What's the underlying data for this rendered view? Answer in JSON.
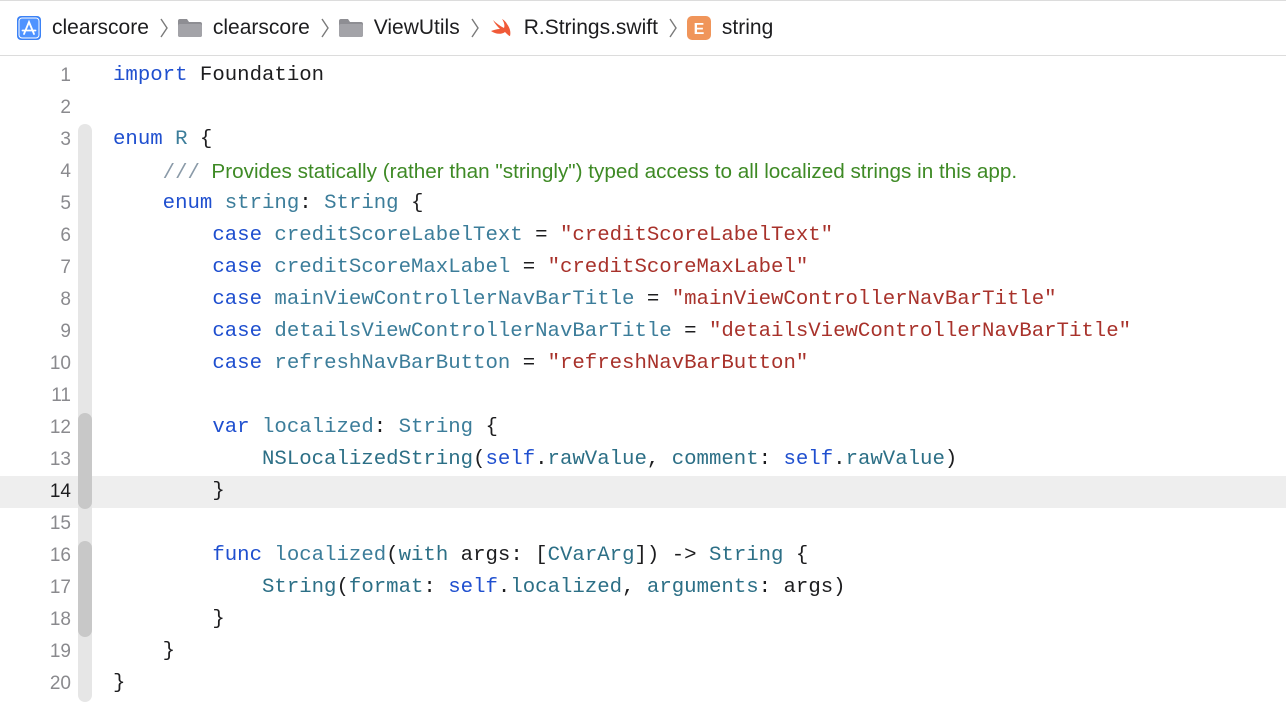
{
  "breadcrumb": [
    {
      "label": "clearscore",
      "icon": "app-project-icon"
    },
    {
      "label": "clearscore",
      "icon": "folder-icon"
    },
    {
      "label": "ViewUtils",
      "icon": "folder-icon"
    },
    {
      "label": "R.Strings.swift",
      "icon": "swift-file-icon"
    },
    {
      "label": "string",
      "icon": "enum-icon",
      "icon_letter": "E"
    }
  ],
  "colors": {
    "keyword": "#1f4fcf",
    "type": "#3c7d9a",
    "string": "#a8322b",
    "comment": "#3e8a25",
    "enum_badge": "#f0955a",
    "app_icon": "#3b82f6"
  },
  "editor": {
    "current_line": 14,
    "lines": [
      {
        "n": "1",
        "tokens": [
          [
            "kw",
            "import"
          ],
          [
            "pl",
            " Foundation"
          ]
        ]
      },
      {
        "n": "2",
        "tokens": []
      },
      {
        "n": "3",
        "tokens": [
          [
            "kw",
            "enum"
          ],
          [
            "pl",
            " "
          ],
          [
            "ty",
            "R"
          ],
          [
            "pl",
            " {"
          ]
        ]
      },
      {
        "n": "4",
        "tokens": [
          [
            "pl",
            "    "
          ],
          [
            "cmt-slash",
            "///"
          ],
          [
            "cmt",
            "  Provides statically (rather than \"stringly\") typed access to all localized strings in this app."
          ]
        ]
      },
      {
        "n": "5",
        "tokens": [
          [
            "pl",
            "    "
          ],
          [
            "kw",
            "enum"
          ],
          [
            "pl",
            " "
          ],
          [
            "ty",
            "string"
          ],
          [
            "pl",
            ": "
          ],
          [
            "ty",
            "String"
          ],
          [
            "pl",
            " {"
          ]
        ]
      },
      {
        "n": "6",
        "tokens": [
          [
            "pl",
            "        "
          ],
          [
            "kw",
            "case"
          ],
          [
            "pl",
            " "
          ],
          [
            "ty",
            "creditScoreLabelText"
          ],
          [
            "pl",
            " = "
          ],
          [
            "str",
            "\"creditScoreLabelText\""
          ]
        ]
      },
      {
        "n": "7",
        "tokens": [
          [
            "pl",
            "        "
          ],
          [
            "kw",
            "case"
          ],
          [
            "pl",
            " "
          ],
          [
            "ty",
            "creditScoreMaxLabel"
          ],
          [
            "pl",
            " = "
          ],
          [
            "str",
            "\"creditScoreMaxLabel\""
          ]
        ]
      },
      {
        "n": "8",
        "tokens": [
          [
            "pl",
            "        "
          ],
          [
            "kw",
            "case"
          ],
          [
            "pl",
            " "
          ],
          [
            "ty",
            "mainViewControllerNavBarTitle"
          ],
          [
            "pl",
            " = "
          ],
          [
            "str",
            "\"mainViewControllerNavBarTitle\""
          ]
        ]
      },
      {
        "n": "9",
        "tokens": [
          [
            "pl",
            "        "
          ],
          [
            "kw",
            "case"
          ],
          [
            "pl",
            " "
          ],
          [
            "ty",
            "detailsViewControllerNavBarTitle"
          ],
          [
            "pl",
            " = "
          ],
          [
            "str",
            "\"detailsViewControllerNavBarTitle\""
          ]
        ]
      },
      {
        "n": "10",
        "tokens": [
          [
            "pl",
            "        "
          ],
          [
            "kw",
            "case"
          ],
          [
            "pl",
            " "
          ],
          [
            "ty",
            "refreshNavBarButton"
          ],
          [
            "pl",
            " = "
          ],
          [
            "str",
            "\"refreshNavBarButton\""
          ]
        ]
      },
      {
        "n": "11",
        "tokens": []
      },
      {
        "n": "12",
        "tokens": [
          [
            "pl",
            "        "
          ],
          [
            "kw",
            "var"
          ],
          [
            "pl",
            " "
          ],
          [
            "ty",
            "localized"
          ],
          [
            "pl",
            ": "
          ],
          [
            "ty",
            "String"
          ],
          [
            "pl",
            " {"
          ]
        ]
      },
      {
        "n": "13",
        "tokens": [
          [
            "pl",
            "            "
          ],
          [
            "cl",
            "NSLocalizedString"
          ],
          [
            "pl",
            "("
          ],
          [
            "kw",
            "self"
          ],
          [
            "pl",
            "."
          ],
          [
            "cl",
            "rawValue"
          ],
          [
            "pl",
            ", "
          ],
          [
            "cl",
            "comment"
          ],
          [
            "pl",
            ": "
          ],
          [
            "kw",
            "self"
          ],
          [
            "pl",
            "."
          ],
          [
            "cl",
            "rawValue"
          ],
          [
            "pl",
            ")"
          ]
        ]
      },
      {
        "n": "14",
        "tokens": [
          [
            "pl",
            "        }"
          ]
        ]
      },
      {
        "n": "15",
        "tokens": []
      },
      {
        "n": "16",
        "tokens": [
          [
            "pl",
            "        "
          ],
          [
            "kw",
            "func"
          ],
          [
            "pl",
            " "
          ],
          [
            "ty",
            "localized"
          ],
          [
            "pl",
            "("
          ],
          [
            "cl",
            "with"
          ],
          [
            "pl",
            " args: ["
          ],
          [
            "cl",
            "CVarArg"
          ],
          [
            "pl",
            "]) -> "
          ],
          [
            "cl",
            "String"
          ],
          [
            "pl",
            " {"
          ]
        ]
      },
      {
        "n": "17",
        "tokens": [
          [
            "pl",
            "            "
          ],
          [
            "cl",
            "String"
          ],
          [
            "pl",
            "("
          ],
          [
            "cl",
            "format"
          ],
          [
            "pl",
            ": "
          ],
          [
            "kw",
            "self"
          ],
          [
            "pl",
            "."
          ],
          [
            "cl",
            "localized"
          ],
          [
            "pl",
            ", "
          ],
          [
            "cl",
            "arguments"
          ],
          [
            "pl",
            ": args)"
          ]
        ]
      },
      {
        "n": "18",
        "tokens": [
          [
            "pl",
            "        }"
          ]
        ]
      },
      {
        "n": "19",
        "tokens": [
          [
            "pl",
            "    }"
          ]
        ]
      },
      {
        "n": "20",
        "tokens": [
          [
            "pl",
            "}"
          ]
        ]
      }
    ]
  }
}
